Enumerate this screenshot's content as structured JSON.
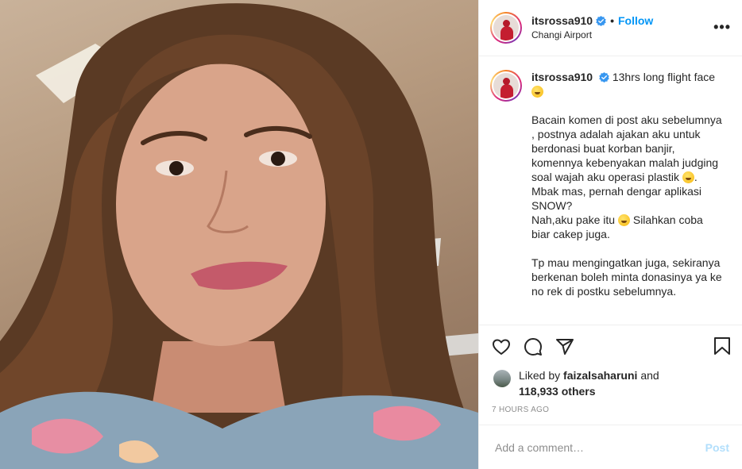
{
  "header": {
    "username": "itsrossa910",
    "follow_label": "Follow",
    "dot": "•",
    "location": "Changi Airport",
    "more_label": "•••"
  },
  "caption": {
    "username": "itsrossa910",
    "title": "13hrs long flight face",
    "para1_a": "Bacain komen di post aku sebelumnya , postnya adalah ajakan aku untuk berdonasi buat korban banjir, komennya kebenyakan malah judging soal wajah aku operasi plastik ",
    "para1_b": ". Mbak mas, pernah dengar aplikasi SNOW?\nNah,aku pake itu ",
    "para1_c": " Silahkan coba biar cakep juga.",
    "para2": "Tp mau mengingatkan juga, sekiranya berkenan boleh minta donasinya ya ke no rek di postku sebelumnya."
  },
  "likes": {
    "prefix": "Liked by",
    "liker": "faizalsaharuni",
    "and": "and",
    "others": "118,933 others"
  },
  "timestamp": "7 HOURS AGO",
  "comment": {
    "placeholder": "Add a comment…",
    "post_label": "Post"
  },
  "colors": {
    "accent": "#0095f6",
    "post_disabled": "#b2dffc",
    "muted": "#8e8e8e"
  },
  "icons": [
    "heart-icon",
    "comment-icon",
    "share-icon",
    "bookmark-icon",
    "verified-badge-icon",
    "more-options-icon"
  ]
}
